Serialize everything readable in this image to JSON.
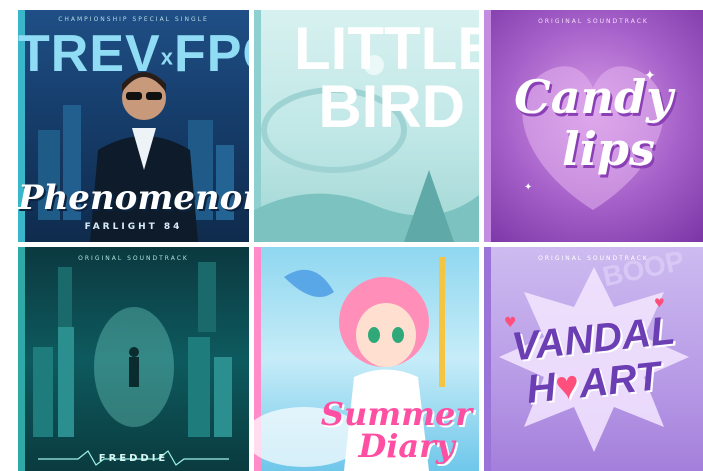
{
  "tiles": [
    {
      "id": "trev-x-fpc",
      "top_line": "CHAMPIONSHIP SPECIAL SINGLE",
      "title_left": "TREV",
      "title_x": "x",
      "title_right": "FPC",
      "script_title": "Phenomenon",
      "footer": "FARLIGHT 84",
      "colors": {
        "bg": "#163d6b",
        "title": "#8fdcf4",
        "script": "#ffffff",
        "spine": "#39b6c9"
      }
    },
    {
      "id": "little-bird",
      "title_line1": "LITTLE",
      "title_line2": "BIRD",
      "colors": {
        "bg": "#bfe7e6",
        "title": "#ffffff",
        "spine": "#8ed0cf"
      }
    },
    {
      "id": "candy-lips",
      "top_line": "ORIGINAL SOUNDTRACK",
      "script_line1": "Candy",
      "script_line2": "lips",
      "colors": {
        "bg": "#a45fc8",
        "script": "#ffffff",
        "spine": "#c48ce0"
      }
    },
    {
      "id": "freddie",
      "top_line": "ORIGINAL SOUNDTRACK",
      "footer": "FREDDIE",
      "colors": {
        "bg": "#0d5a5e",
        "footer": "#d8f6f2",
        "spine": "#2ea9a6"
      }
    },
    {
      "id": "summer-diary",
      "script_line1": "Summer",
      "script_line2": "Diary",
      "colors": {
        "bg": "#8fd7f0",
        "script": "#ff4fa3",
        "spine": "#ff8cc8"
      }
    },
    {
      "id": "vandal-heart",
      "top_line": "ORIGINAL SOUNDTRACK",
      "title_line1": "VANDAL",
      "title_line2_a": "H",
      "title_line2_b": "ART",
      "heart": "♥",
      "background_word": "BOOP",
      "colors": {
        "bg": "#b79ae6",
        "title": "#6b3fb3",
        "heart": "#ff4f7d",
        "spine": "#9a73d8"
      }
    }
  ]
}
